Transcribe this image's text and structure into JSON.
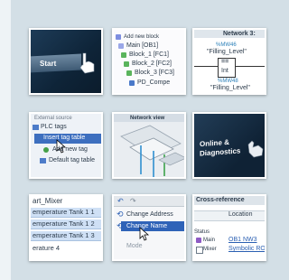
{
  "tiles": {
    "start": {
      "label": "Start"
    },
    "program_blocks": {
      "items": [
        "Add new block",
        "Main [OB1]",
        "Block_1 [FC1]",
        "Block_2 [FC2]",
        "Block_3 [FC3]",
        "PD_Compe"
      ]
    },
    "network_logic": {
      "header": "Network 3:",
      "tag1": "%MW46",
      "var1": "\"Filling_Level\"",
      "op1": "==",
      "type": "Int",
      "tag2": "%MW48",
      "var2": "\"Filling_Level\""
    },
    "plc_tags": {
      "items": [
        "External source",
        "PLC tags",
        "Insert tag table",
        "Add new tag",
        "Default tag table"
      ]
    },
    "network_view": {
      "label": "Network view"
    },
    "online": {
      "line1": "Online &",
      "line2": "Diagnostics"
    },
    "hmi_tags": {
      "header": "art_Mixer",
      "rows": [
        "emperature Tank 1 1",
        "emperature Tank 1 2",
        "emperature Tank 1 3",
        "erature 4"
      ]
    },
    "change_menu": {
      "items": [
        "Change Address",
        "Change Name",
        "Mode"
      ]
    },
    "cross_reference": {
      "header": "Cross-reference",
      "column": "Location",
      "status_label": "Status",
      "rows": [
        {
          "name": "Main",
          "loc": "OB1 NW3"
        },
        {
          "name": "Mixer",
          "loc": "Symbolic RO"
        }
      ]
    }
  }
}
